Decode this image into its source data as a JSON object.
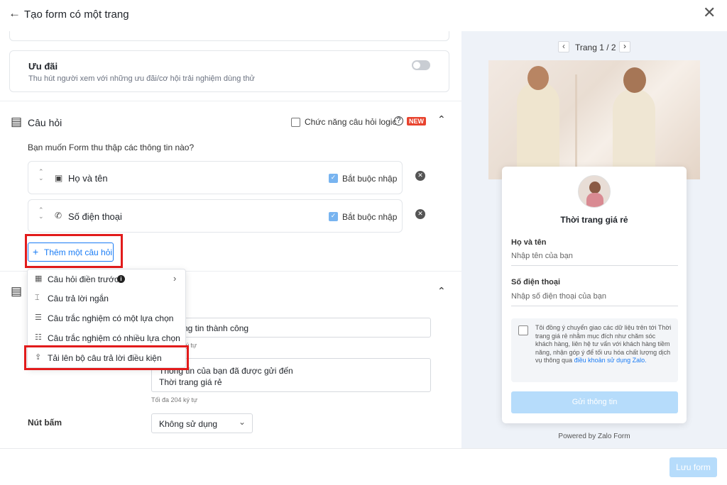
{
  "header": {
    "back_icon": "arrow-left-icon",
    "title": "Tạo form có một trang",
    "close_icon": "close-icon"
  },
  "offer": {
    "title": "Ưu đãi",
    "description": "Thu hút người xem với những ưu đãi/cơ hội trải nghiệm dùng thử",
    "toggle_on": false
  },
  "questions": {
    "title": "Câu hỏi",
    "logic_label": "Chức năng câu hỏi logic",
    "new_badge": "NEW",
    "prompt": "Bạn muốn Form thu thập các thông tin nào?",
    "items": [
      {
        "label": "Họ và tên",
        "required_label": "Bắt buộc nhập",
        "icon": "id-card-icon"
      },
      {
        "label": "Số điện thoại",
        "required_label": "Bắt buộc nhập",
        "icon": "phone-icon"
      }
    ],
    "add_button": "Thêm một câu hỏi"
  },
  "dropdown_menu": {
    "items": [
      {
        "label": "Câu hỏi điền trước",
        "icon": "prefill-icon"
      },
      {
        "label": "Câu trả lời ngắn",
        "icon": "short-answer-icon"
      },
      {
        "label": "Câu trắc nghiệm có một lựa chọn",
        "icon": "single-choice-icon"
      },
      {
        "label": "Câu trắc nghiệm có nhiều lựa chọn",
        "icon": "multi-choice-icon"
      },
      {
        "label": "Tải lên bộ câu trả lời điều kiện",
        "icon": "upload-icon"
      }
    ]
  },
  "completion": {
    "title_value": "ng tin thành công",
    "title_note": "ký tự",
    "message_line1": "Thông tin của bạn đã được gửi đến",
    "message_line2": "Thời trang giá rẻ",
    "message_note": "Tối đa 204 ký tự",
    "button_label": "Nút bấm",
    "button_value": "Không sử dụng"
  },
  "preview": {
    "pagination": "Trang 1 / 2",
    "brand_name": "Thời trang giá rẻ",
    "fields": [
      {
        "label": "Họ và tên",
        "placeholder": "Nhập tên của bạn"
      },
      {
        "label": "Số điện thoại",
        "placeholder": "Nhập số điện thoại của bạn"
      }
    ],
    "consent_text": "Tôi đồng ý chuyển giao các dữ liệu trên tới Thời trang giá rẻ nhằm mục đích như chăm sóc khách hàng, liên hệ tư vấn với khách hàng tiềm năng, nhận góp ý để tối ưu hóa chất lượng dịch vụ thông qua",
    "consent_link": "điều khoản sử dụng Zalo.",
    "submit_label": "Gửi thông tin",
    "powered_by": "Powered by Zalo Form"
  },
  "footer": {
    "save_label": "Lưu form"
  },
  "colors": {
    "accent": "#1a7cf5",
    "highlight": "#e21b1b",
    "submit_disabled": "#b6dcfb",
    "badge": "#e8432e"
  }
}
